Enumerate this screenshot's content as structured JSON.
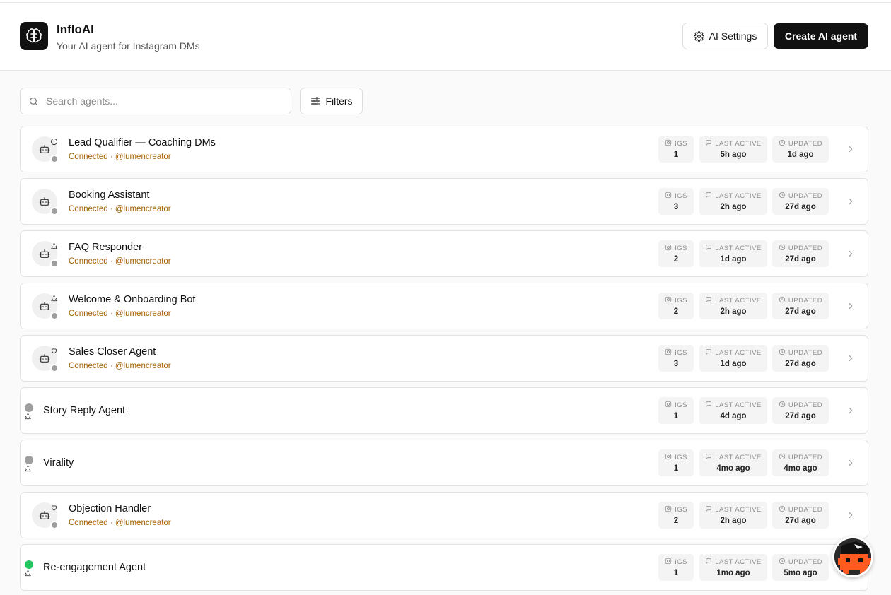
{
  "app": {
    "title": "InfloAI",
    "subtitle": "Your AI agent for Instagram DMs",
    "logo_icon": "brain-icon"
  },
  "header": {
    "settings_label": "AI Settings",
    "create_label": "Create AI agent"
  },
  "search": {
    "placeholder": "Search agents...",
    "value": ""
  },
  "filters_label": "Filters",
  "stat_labels": {
    "igs": "IGS",
    "last_active": "LAST ACTIVE",
    "updated": "UPDATED"
  },
  "colors": {
    "connected_text": "#a35f00",
    "status_offline": "#9e9e9e",
    "status_online": "#22c55e",
    "primary": "#111111"
  },
  "agents": [
    {
      "name": "Lead Qualifier — Coaching DMs",
      "status": "Connected · @lumencreator",
      "igs": "1",
      "last_active": "5h ago",
      "updated": "1d ago",
      "badge_icon": "alert-circle-icon",
      "layout": "full"
    },
    {
      "name": "Booking Assistant",
      "status": "Connected · @lumencreator",
      "igs": "3",
      "last_active": "2h ago",
      "updated": "27d ago",
      "badge_icon": "",
      "layout": "full"
    },
    {
      "name": "FAQ Responder",
      "status": "Connected · @lumencreator",
      "igs": "2",
      "last_active": "1d ago",
      "updated": "27d ago",
      "badge_icon": "recycle-icon",
      "layout": "full"
    },
    {
      "name": "Welcome & Onboarding Bot",
      "status": "Connected · @lumencreator",
      "igs": "2",
      "last_active": "2h ago",
      "updated": "27d ago",
      "badge_icon": "recycle-icon",
      "layout": "full"
    },
    {
      "name": "Sales Closer Agent",
      "status": "Connected · @lumencreator",
      "igs": "3",
      "last_active": "1d ago",
      "updated": "27d ago",
      "badge_icon": "heart-icon",
      "layout": "full"
    },
    {
      "name": "Story Reply Agent",
      "status": "",
      "igs": "1",
      "last_active": "4d ago",
      "updated": "27d ago",
      "badge_icon": "recycle-icon",
      "layout": "simple",
      "online": false
    },
    {
      "name": "Virality",
      "status": "",
      "igs": "1",
      "last_active": "4mo ago",
      "updated": "4mo ago",
      "badge_icon": "recycle-icon",
      "layout": "simple",
      "online": false
    },
    {
      "name": "Objection Handler",
      "status": "Connected · @lumencreator",
      "igs": "2",
      "last_active": "2h ago",
      "updated": "27d ago",
      "badge_icon": "heart-icon",
      "layout": "full"
    },
    {
      "name": "Re-engagement Agent",
      "status": "",
      "igs": "1",
      "last_active": "1mo ago",
      "updated": "5mo ago",
      "badge_icon": "recycle-icon",
      "layout": "simple",
      "online": true
    }
  ]
}
